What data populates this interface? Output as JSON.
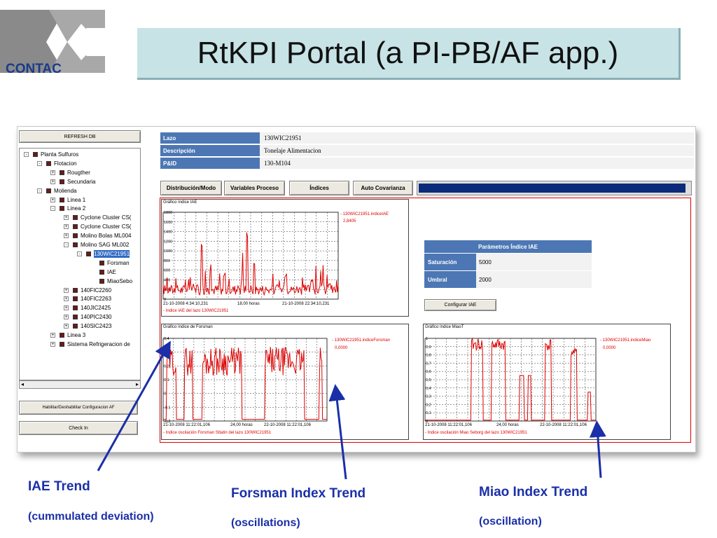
{
  "slide": {
    "logo_text": "CONTAC",
    "title": "RtKPI Portal (a PI-PB/AF app.)"
  },
  "left": {
    "refresh_label": "REFRESH DB",
    "toggle_label": "Habilitar/Deshabilitar Configuracion AF",
    "checkin_label": "Check In",
    "tree": [
      {
        "label": "Planta Sulfuros",
        "level": 0,
        "expander": "-",
        "selected": false
      },
      {
        "label": "Flotacion",
        "level": 1,
        "expander": "-",
        "selected": false
      },
      {
        "label": "Rougther",
        "level": 2,
        "expander": "+",
        "selected": false
      },
      {
        "label": "Secundaria",
        "level": 2,
        "expander": "+",
        "selected": false
      },
      {
        "label": "Molienda",
        "level": 1,
        "expander": "-",
        "selected": false
      },
      {
        "label": "Linea 1",
        "level": 2,
        "expander": "+",
        "selected": false
      },
      {
        "label": "Linea 2",
        "level": 2,
        "expander": "-",
        "selected": false
      },
      {
        "label": "Cyclone Cluster CS(",
        "level": 3,
        "expander": "+",
        "selected": false
      },
      {
        "label": "Cyclone Cluster CS(",
        "level": 3,
        "expander": "+",
        "selected": false
      },
      {
        "label": "Molino Bolas ML004",
        "level": 3,
        "expander": "+",
        "selected": false
      },
      {
        "label": "Molino SAG ML002",
        "level": 3,
        "expander": "-",
        "selected": false
      },
      {
        "label": "130WIC21951",
        "level": 4,
        "expander": "-",
        "selected": true
      },
      {
        "label": "Forsman",
        "level": 5,
        "expander": "",
        "selected": false
      },
      {
        "label": "IAE",
        "level": 5,
        "expander": "",
        "selected": false
      },
      {
        "label": "MiaoSebo",
        "level": 5,
        "expander": "",
        "selected": false
      },
      {
        "label": "140FIC2260",
        "level": 3,
        "expander": "+",
        "selected": false
      },
      {
        "label": "140FIC2263",
        "level": 3,
        "expander": "+",
        "selected": false
      },
      {
        "label": "140JIC2425",
        "level": 3,
        "expander": "+",
        "selected": false
      },
      {
        "label": "140PIC2430",
        "level": 3,
        "expander": "+",
        "selected": false
      },
      {
        "label": "140SIC2423",
        "level": 3,
        "expander": "+",
        "selected": false
      },
      {
        "label": "Linea 3",
        "level": 2,
        "expander": "+",
        "selected": false
      },
      {
        "label": "Sistema Refrigeracion de",
        "level": 2,
        "expander": "+",
        "selected": false
      }
    ]
  },
  "info": {
    "lazo_label": "Lazo",
    "lazo_value": "130WIC21951",
    "desc_label": "Descripción",
    "desc_value": "Tonelaje Alimentacion",
    "pid_label": "P&ID",
    "pid_value": "130-M104"
  },
  "tabs": [
    "Distribución/Modo",
    "Variables Proceso",
    "Índices",
    "Auto Covarianza"
  ],
  "params": {
    "title": "Parámetros Índice IAE",
    "saturacion_label": "Saturación",
    "saturacion_value": "5000",
    "umbral_label": "Umbral",
    "umbral_value": "2000",
    "configure_label": "Configurar IAE"
  },
  "charts": {
    "iae": {
      "title": "Gráfico índice IAE",
      "legend_line1": "- 130WIC21951.indiceIAE",
      "legend_line2": "2,8405",
      "x_start": "21-10-2008 4:34:10,231",
      "x_mid": "18,00 horas",
      "x_end": "21-10-2008 22:34:10,231",
      "caption": "- Indice IAE del lazo 130WIC21951",
      "y_ticks": [
        "1800",
        "1600",
        "1400",
        "1200",
        "1000",
        "800",
        "600",
        "400",
        "200",
        "0"
      ]
    },
    "forsman": {
      "title": "Gráfico índice de Forsman",
      "legend_line1": "- 130WIC21951.indiceForsman",
      "legend_line2": "0,0000",
      "x_start": "21-10-2008 11:22:01,106",
      "x_mid": "24,00 horas",
      "x_end": "22-10-2008 11:22:01,106",
      "caption": "- Indice oscilación Forsman Sttatin del lazo 130WIC21951",
      "y_ticks": [
        "0,4",
        "0,3",
        "0,2",
        "0,1",
        "0",
        "-0,1",
        "-0,2"
      ]
    },
    "miao": {
      "title": "Gráfico índice MiaoT",
      "legend_line1": "- 130WIC21951.indiceMiao",
      "legend_line2": "0,0000",
      "x_start": "21-10-2008 11:22:01,106",
      "x_mid": "24,00 horas",
      "x_end": "22-10-2008 11:22:01,106",
      "caption": "- Indice oscilación Miao Seborg del lazo 130WIC21951",
      "y_ticks": [
        "1",
        "0,9",
        "0,8",
        "0,7",
        "0,6",
        "0,5",
        "0,4",
        "0,3",
        "0,2",
        "0,1",
        "0"
      ]
    }
  },
  "annotations": {
    "iae_title": "IAE Trend",
    "iae_sub": "(cummulated deviation)",
    "forsman_title": "Forsman Index Trend",
    "forsman_sub": "(oscillations)",
    "miao_title": "Miao Index Trend",
    "miao_sub": "(oscillation)"
  },
  "colors": {
    "accent_blue": "#4c77b4",
    "trend_red": "#dd0000",
    "annotation_blue": "#1a2fa8",
    "title_bg": "#c7e3e6"
  }
}
